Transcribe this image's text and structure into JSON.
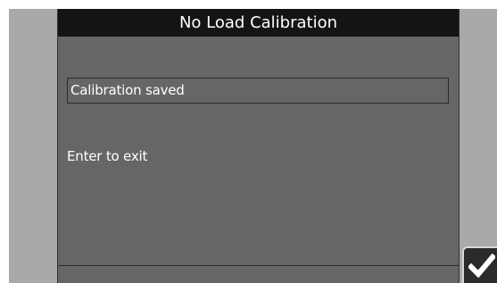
{
  "header": {
    "title": "No Load Calibration"
  },
  "content": {
    "status_text": "Calibration saved",
    "hint_text": "Enter to exit"
  },
  "controls": {
    "confirm_icon": "checkmark-icon"
  },
  "colors": {
    "title_bar": "#141414",
    "panel": "#676667",
    "side_frame": "#a9a9aa",
    "text": "#ffffff"
  }
}
